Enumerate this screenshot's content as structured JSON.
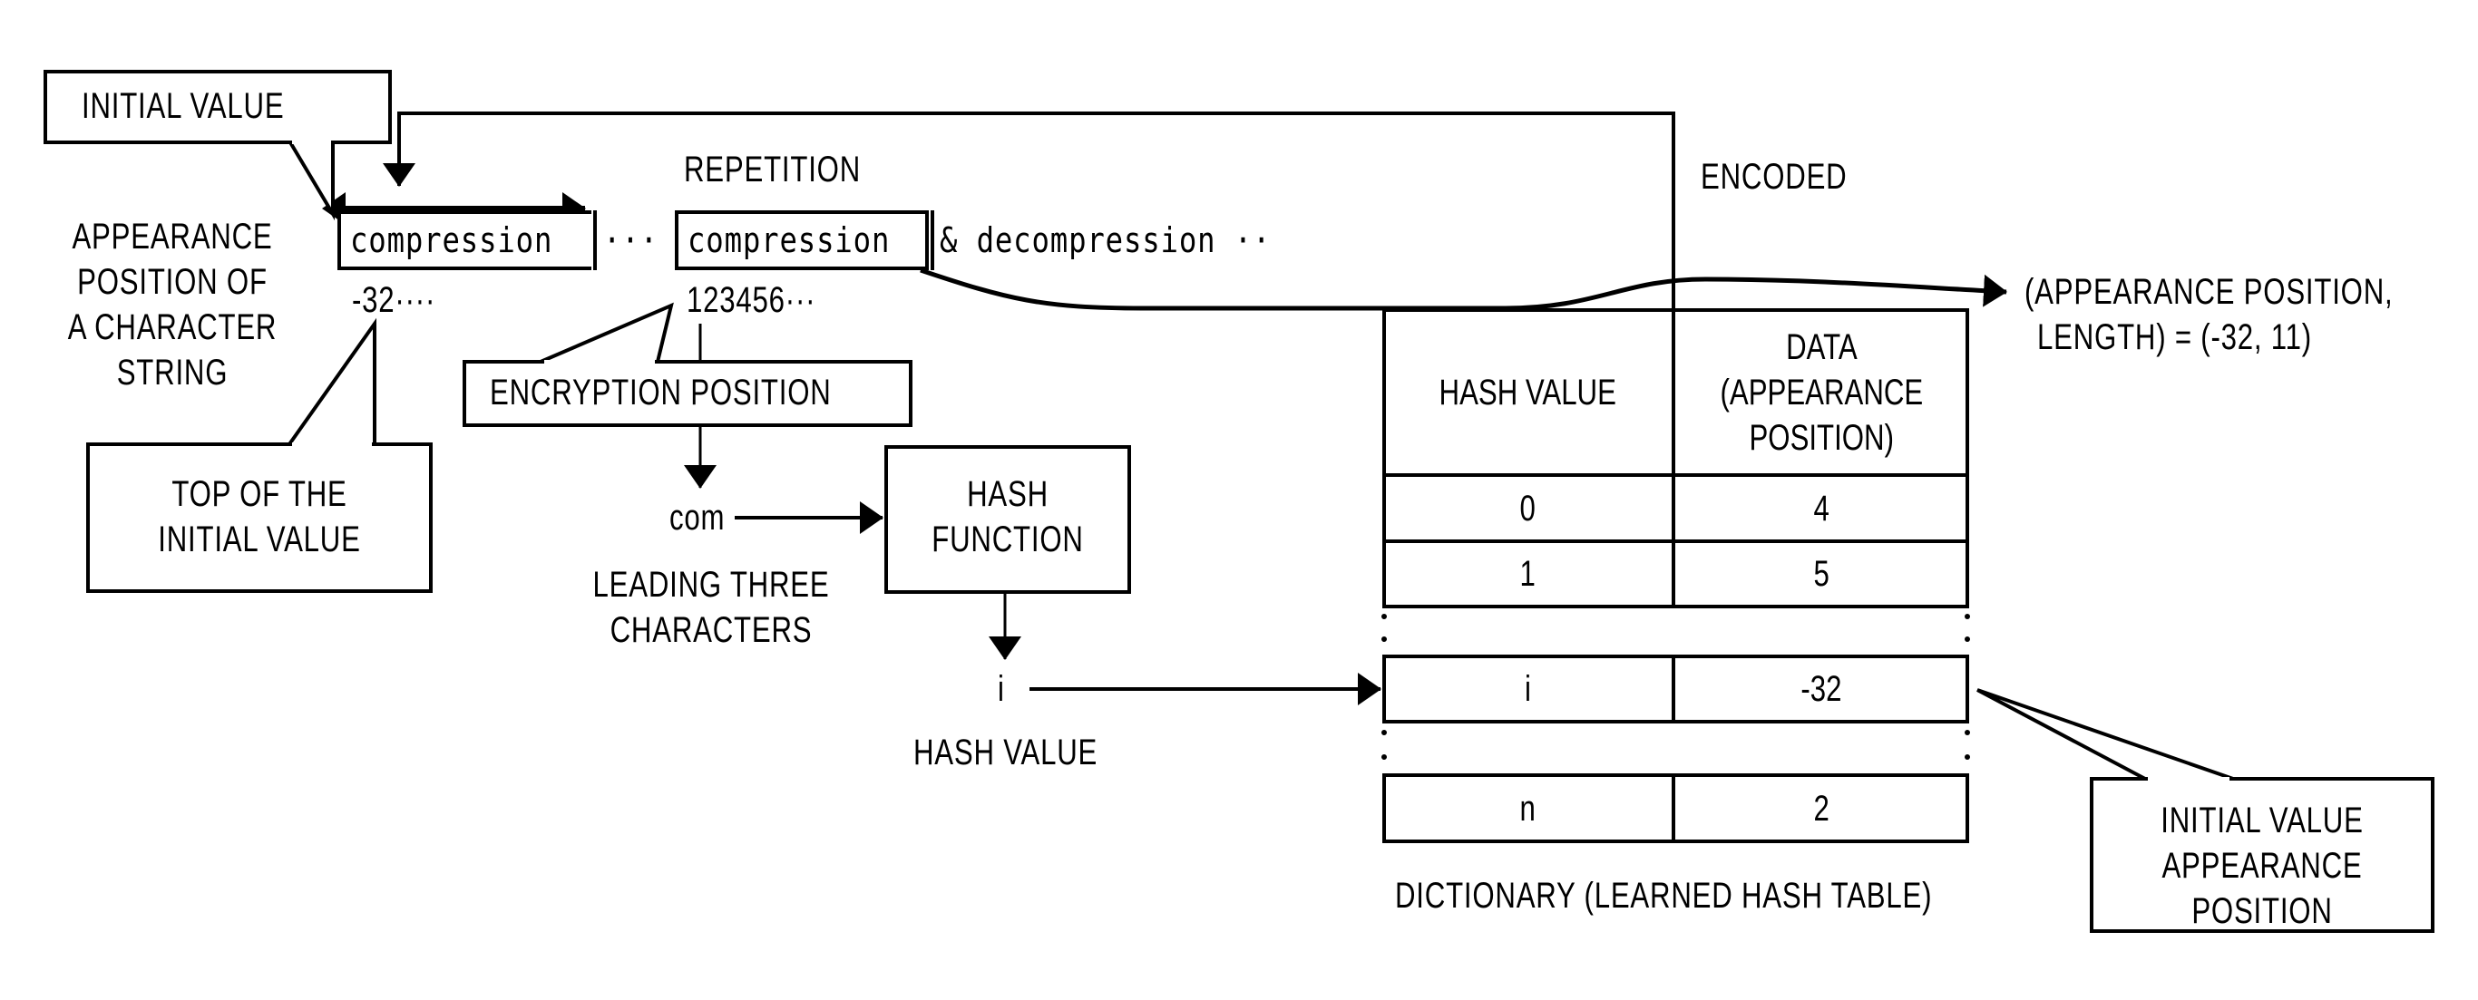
{
  "labels": {
    "initial_value": "INITIAL VALUE",
    "repetition": "REPETITION",
    "encoded": "ENCODED",
    "appearance_position_of_string": [
      "APPEARANCE",
      "POSITION OF",
      "A CHARACTER",
      "STRING"
    ],
    "word1": "compression",
    "ellipsis_between": "···",
    "word2": "compression",
    "rest_text": "& decompression ··",
    "position_1": "-32····",
    "position_2": "123456···",
    "encryption_position": "ENCRYPTION POSITION",
    "top_of_initial_value": [
      "TOP OF THE",
      "INITIAL VALUE"
    ],
    "leading_chars": "com",
    "leading_three_characters": [
      "LEADING THREE",
      "CHARACTERS"
    ],
    "hash_function": [
      "HASH",
      "FUNCTION"
    ],
    "hash_output": "i",
    "hash_value": "HASH VALUE",
    "output_tuple": [
      "(APPEARANCE POSITION,",
      "LENGTH) = (-32, 11)"
    ],
    "dictionary_caption": "DICTIONARY (LEARNED HASH TABLE)",
    "initial_value_appearance_position": [
      "INITIAL VALUE",
      "APPEARANCE",
      "POSITION"
    ]
  },
  "table": {
    "headers": [
      "HASH VALUE",
      [
        "DATA",
        "(APPEARANCE",
        "POSITION)"
      ]
    ],
    "rows": [
      {
        "hash": "0",
        "data": "4"
      },
      {
        "hash": "1",
        "data": "5"
      },
      {
        "hash": "i",
        "data": "-32"
      },
      {
        "hash": "n",
        "data": "2"
      }
    ]
  }
}
